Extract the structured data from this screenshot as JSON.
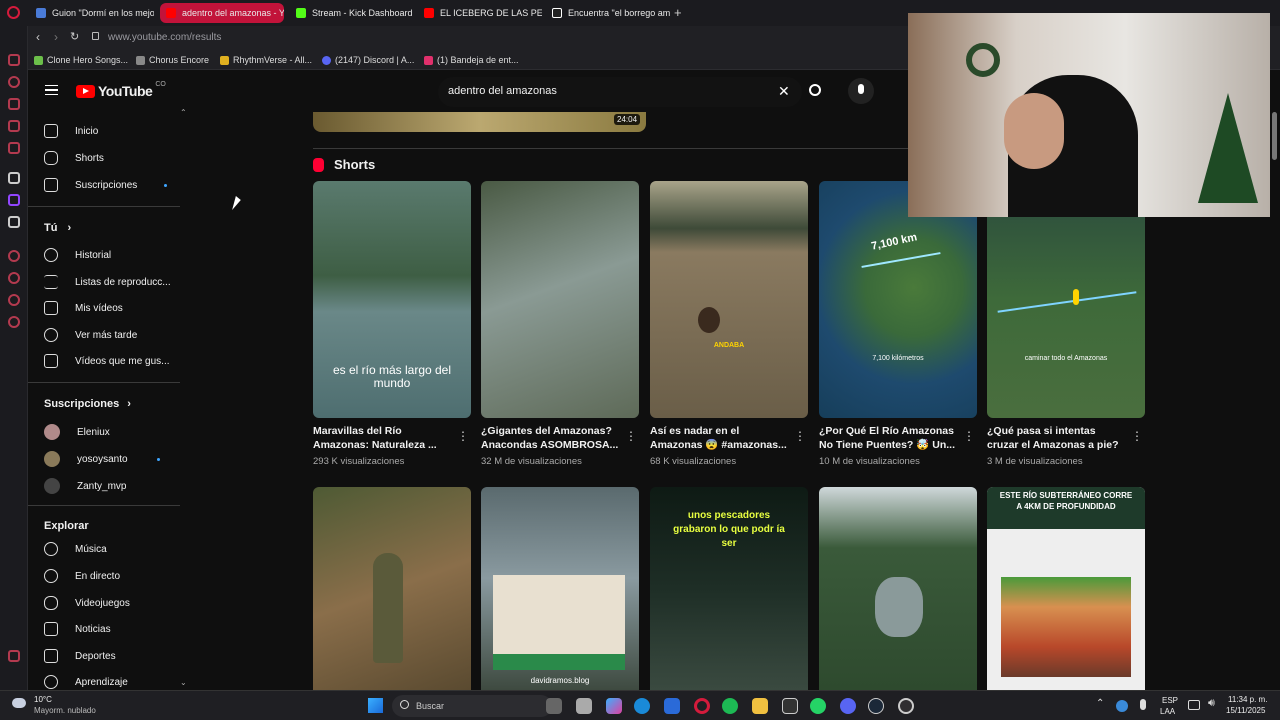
{
  "browser": {
    "tabs": [
      {
        "label": "Guion \"Dormí en los mejo",
        "color": "#4a7bd8"
      },
      {
        "label": "adentro del amazonas - Y",
        "color": "#ff0000"
      },
      {
        "label": "Stream - Kick Dashboard",
        "color": "#53fc18"
      },
      {
        "label": "EL ICEBERG DE LAS PELI",
        "color": "#ff0000"
      },
      {
        "label": "Encuentra \"el borrego am",
        "color": "#ffffff"
      }
    ],
    "add_tab": "+",
    "url": "www.youtube.com/results",
    "bookmarks": [
      {
        "label": "Clone Hero Songs...",
        "color": "#6cbf4a"
      },
      {
        "label": "Chorus Encore",
        "color": "#888888"
      },
      {
        "label": "RhythmVerse - All...",
        "color": "#e0b020"
      },
      {
        "label": "(2147) Discord | A...",
        "color": "#5865f2"
      },
      {
        "label": "(1) Bandeja de ent...",
        "color": "#e1306c"
      }
    ]
  },
  "youtube": {
    "logo": "YouTube",
    "country": "CO",
    "search_query": "adentro del amazonas",
    "prev_duration": "24:04",
    "shorts_heading": "Shorts"
  },
  "sidebar": {
    "main": [
      "Inicio",
      "Shorts",
      "Suscripciones"
    ],
    "you_heading": "Tú",
    "you_items": [
      "Historial",
      "Listas de reproducc...",
      "Mis vídeos",
      "Ver más tarde",
      "Vídeos que me gus..."
    ],
    "subs_heading": "Suscripciones",
    "subs": [
      "Eleniux",
      "yosoysanto",
      "Zanty_mvp"
    ],
    "explore_heading": "Explorar",
    "explore": [
      "Música",
      "En directo",
      "Videojuegos",
      "Noticias",
      "Deportes",
      "Aprendizaje"
    ]
  },
  "shorts_row1": [
    {
      "title": "Maravillas del Río Amazonas: Naturaleza ...",
      "views": "293 K visualizaciones",
      "overlay": "es el río más largo del mundo",
      "bg": "#4d6a55"
    },
    {
      "title": "¿Gigantes del Amazonas? Anacondas ASOMBROSA...",
      "views": "32 M de visualizaciones",
      "overlay": "",
      "bg": "#6c7a6e"
    },
    {
      "title": "Así es nadar en el Amazonas 😨 #amazonas...",
      "views": "68 K visualizaciones",
      "overlay": "ANDABA",
      "bg": "#8d8264"
    },
    {
      "title": "¿Por Qué El Río Amazonas No Tiene Puentes? 🤯 Un...",
      "views": "10 M de visualizaciones",
      "overlay": "7,100 kilómetros",
      "bg": "#2f5a6e"
    },
    {
      "title": "¿Qué pasa si intentas cruzar el Amazonas a pie?",
      "views": "3 M de visualizaciones",
      "overlay": "caminar todo el Amazonas",
      "bg": "#2e5a44"
    }
  ],
  "map_label": "7,100 km",
  "shorts_row2": [
    {
      "overlay": "",
      "bg": "#6a5a3e"
    },
    {
      "overlay": "davidramos.blog",
      "bg": "#3c4a4a"
    },
    {
      "overlay": "unos pescadores grabaron lo que podr ía ser",
      "bg": "#1c2a24"
    },
    {
      "overlay": "",
      "bg": "#5a6a5c"
    },
    {
      "overlay": "ESTE RÍO SUBTERRÁNEO CORRE A 4KM DE PROFUNDIDAD",
      "bg": "#e8e8e8"
    }
  ],
  "taskbar": {
    "weather_temp": "10°C",
    "weather_desc": "Mayorm. nublado",
    "search": "Buscar",
    "lang": "ESP",
    "lang2": "LAA",
    "time": "11:34 p. m.",
    "date": "15/11/2025"
  }
}
